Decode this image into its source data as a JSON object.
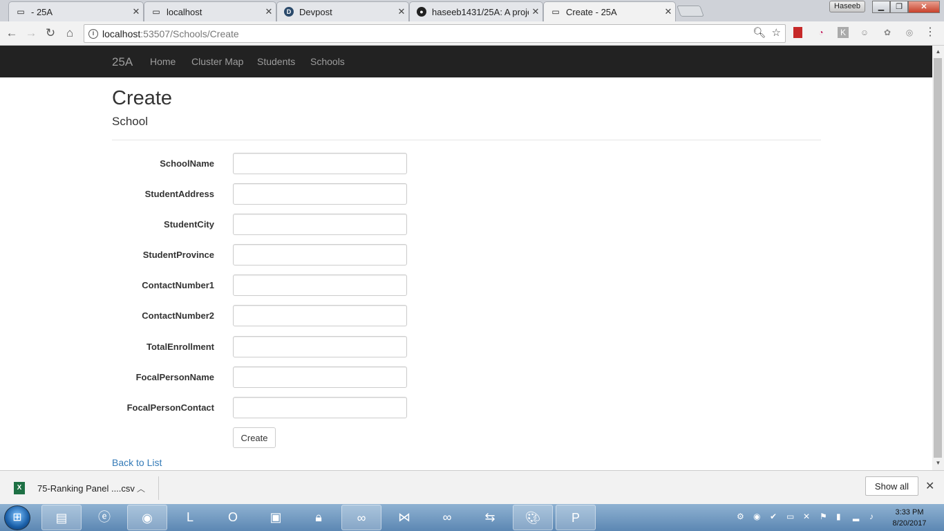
{
  "browser": {
    "tabs": [
      {
        "title": "- 25A",
        "icon": "page-icon"
      },
      {
        "title": "localhost",
        "icon": "page-icon"
      },
      {
        "title": "Devpost",
        "icon": "devpost-icon"
      },
      {
        "title": "haseeb1431/25A: A proje",
        "icon": "github-icon"
      },
      {
        "title": "Create - 25A",
        "icon": "page-icon"
      }
    ],
    "profile": "Haseeb",
    "url_host": "localhost",
    "url_path": ":53507/Schools/Create"
  },
  "navbar": {
    "brand": "25A",
    "links": [
      "Home",
      "Cluster Map",
      "Students",
      "Schools"
    ]
  },
  "page": {
    "title": "Create",
    "subtitle": "School",
    "fields": [
      {
        "label": "SchoolName",
        "value": ""
      },
      {
        "label": "StudentAddress",
        "value": ""
      },
      {
        "label": "StudentCity",
        "value": ""
      },
      {
        "label": "StudentProvince",
        "value": ""
      },
      {
        "label": "ContactNumber1",
        "value": ""
      },
      {
        "label": "ContactNumber2",
        "value": ""
      },
      {
        "label": "TotalEnrollment",
        "value": ""
      },
      {
        "label": "FocalPersonName",
        "value": ""
      },
      {
        "label": "FocalPersonContact",
        "value": ""
      }
    ],
    "submit_label": "Create",
    "back_link": "Back to List"
  },
  "downloads": {
    "file": "75-Ranking Panel ....csv",
    "show_all": "Show all"
  },
  "taskbar": {
    "time": "3:33 PM",
    "date": "8/20/2017"
  }
}
